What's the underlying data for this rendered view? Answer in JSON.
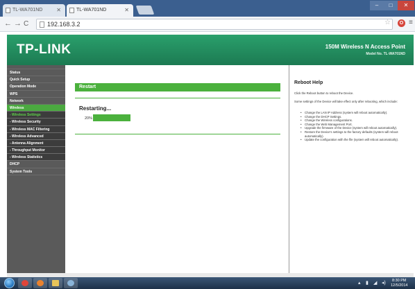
{
  "browser": {
    "tabs": [
      {
        "label": "TL-WA701ND"
      },
      {
        "label": "TL-WA701ND"
      }
    ],
    "url": "192.168.3.2"
  },
  "header": {
    "logo": "TP-LINK",
    "product_title": "150M Wireless N Access Point",
    "model": "Model No. TL-WA701ND"
  },
  "sidebar": {
    "items": [
      {
        "label": "Status"
      },
      {
        "label": "Quick Setup"
      },
      {
        "label": "Operation Mode"
      },
      {
        "label": "WPS"
      },
      {
        "label": "Network"
      },
      {
        "label": "Wireless"
      },
      {
        "label": "- Wireless Settings"
      },
      {
        "label": "- Wireless Security"
      },
      {
        "label": "- Wireless MAC Filtering"
      },
      {
        "label": "- Wireless Advanced"
      },
      {
        "label": "- Antenna Alignment"
      },
      {
        "label": "- Throughput Monitor"
      },
      {
        "label": "- Wireless Statistics"
      },
      {
        "label": "DHCP"
      },
      {
        "label": "System Tools"
      }
    ]
  },
  "main": {
    "section_title": "Restart",
    "status": "Restarting...",
    "progress_label": "20%",
    "progress_value": 20
  },
  "help": {
    "title": "Reboot Help",
    "line1": "Click the Reboot button to reboot the Device.",
    "line2": "Some settings of the Device will take effect only after rebooting, which include:",
    "items": [
      "Change the LAN IP Address (system will reboot automatically).",
      "Change the DHCP Settings.",
      "Change the Wireless configurations.",
      "Change the Web Management Port.",
      "Upgrade the firmware of the Device (system will reboot automatically).",
      "Restore the Device's settings to the factory defaults (system will reboot automatically).",
      "Update the configuration with the file (system will reboot automatically)."
    ]
  },
  "taskbar": {
    "time": "8:30 PM",
    "date": "12/5/2014"
  },
  "colors": {
    "brand_green": "#21845b",
    "accent_green": "#4bb13d",
    "sidebar_bg": "#5a5a5a"
  }
}
